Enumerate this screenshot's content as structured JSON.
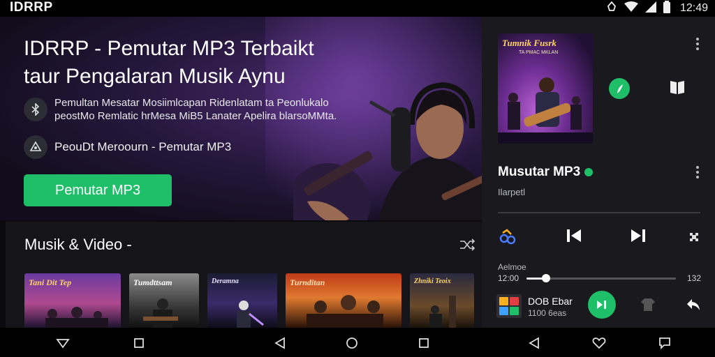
{
  "status_bar": {
    "app_name": "IDRRP",
    "time": "12:49"
  },
  "hero": {
    "title_line1": "IDRRP - Pemutar MP3 Terbaikt",
    "title_line2": "taur Pengalaran Musik Aynu",
    "desc_line1": "Pemultan Mesatar Mosiimlcapan Ridenlatam ta Peonlukalo",
    "desc_line2": "peostMo Remlatic hrMesa MiB5 Lanater Apelira blarsoMMta.",
    "sub_text": "PeouDt Meroourn - Pemutar MP3",
    "cta_label": "Pemutar MP3"
  },
  "section": {
    "title": "Musik & Video -",
    "thumbnails": [
      {
        "label": "Tani Dit Tep"
      },
      {
        "label": "Tumdttsam"
      },
      {
        "label": "Deramna"
      },
      {
        "label": "Turnditan"
      },
      {
        "label": "Zhniki Teoix"
      }
    ]
  },
  "player": {
    "album_title": "Tumnik Fusrk",
    "album_sub": "TA PMAC MKLAN",
    "track_title": "Musutar MP3",
    "artist": "Ilarpetl",
    "elapsed_label": "Aelmoe",
    "elapsed": "12:00",
    "total": "132",
    "progress": 0.13,
    "mini_title": "DOB Ebar",
    "mini_sub": "1100 6eas"
  },
  "colors": {
    "accent": "#1fbf6a",
    "background": "#0b0b0f",
    "panel": "#1a1a1e"
  }
}
